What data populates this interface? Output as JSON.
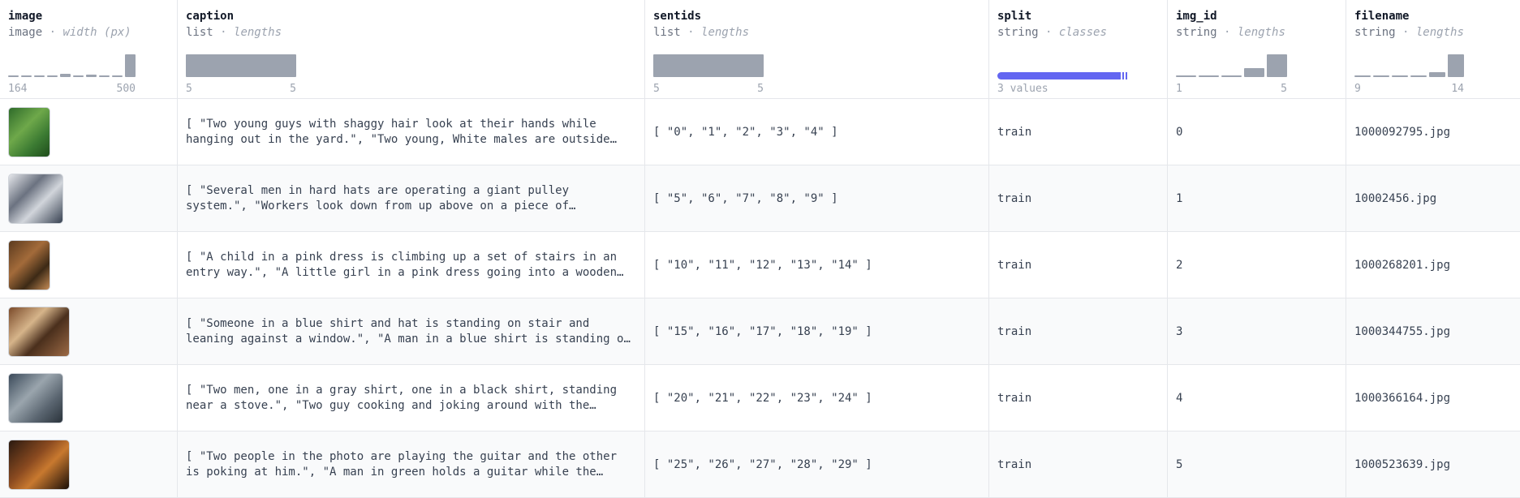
{
  "columns": [
    {
      "name": "image",
      "type": "image",
      "stat": "width (px)",
      "min": "164",
      "max": "500"
    },
    {
      "name": "caption",
      "type": "list",
      "stat": "lengths",
      "min": "5",
      "max": "5"
    },
    {
      "name": "sentids",
      "type": "list",
      "stat": "lengths",
      "min": "5",
      "max": "5"
    },
    {
      "name": "split",
      "type": "string",
      "stat": "classes",
      "summary": "3 values"
    },
    {
      "name": "img_id",
      "type": "string",
      "stat": "lengths",
      "min": "1",
      "max": "5"
    },
    {
      "name": "filename",
      "type": "string",
      "stat": "lengths",
      "min": "9",
      "max": "14"
    }
  ],
  "rows": [
    {
      "caption": "[ \"Two young guys with shaggy hair look at their hands while hanging out in the yard.\", \"Two young, White males are outside near many bushes.\" ]",
      "sentids": "[ \"0\", \"1\", \"2\", \"3\", \"4\" ]",
      "split": "train",
      "img_id": "0",
      "filename": "1000092795.jpg"
    },
    {
      "caption": "[ \"Several men in hard hats are operating a giant pulley system.\", \"Workers look down from up above on a piece of equipment.\" ]",
      "sentids": "[ \"5\", \"6\", \"7\", \"8\", \"9\" ]",
      "split": "train",
      "img_id": "1",
      "filename": "10002456.jpg"
    },
    {
      "caption": "[ \"A child in a pink dress is climbing up a set of stairs in an entry way.\", \"A little girl in a pink dress going into a wooden cabin.\" ]",
      "sentids": "[ \"10\", \"11\", \"12\", \"13\", \"14\" ]",
      "split": "train",
      "img_id": "2",
      "filename": "1000268201.jpg"
    },
    {
      "caption": "[ \"Someone in a blue shirt and hat is standing on stair and leaning against a window.\", \"A man in a blue shirt is standing on a ladder cleaning windows.\" ]",
      "sentids": "[ \"15\", \"16\", \"17\", \"18\", \"19\" ]",
      "split": "train",
      "img_id": "3",
      "filename": "1000344755.jpg"
    },
    {
      "caption": "[ \"Two men, one in a gray shirt, one in a black shirt, standing near a stove.\", \"Two guy cooking and joking around with the camera.\" ]",
      "sentids": "[ \"20\", \"21\", \"22\", \"23\", \"24\" ]",
      "split": "train",
      "img_id": "4",
      "filename": "1000366164.jpg"
    },
    {
      "caption": "[ \"Two people in the photo are playing the guitar and the other is poking at him.\", \"A man in green holds a guitar while the other man observes his shirt.\" ]",
      "sentids": "[ \"25\", \"26\", \"27\", \"28\", \"29\" ]",
      "split": "train",
      "img_id": "5",
      "filename": "1000523639.jpg"
    }
  ],
  "histograms": {
    "image": [
      0.05,
      0.05,
      0.05,
      0.05,
      0.15,
      0.05,
      0.12,
      0.05,
      0.05,
      1.0
    ],
    "caption": [
      1.0
    ],
    "sentids": [
      1.0
    ],
    "img_id": [
      0.05,
      0.05,
      0.05,
      0.4,
      1.0
    ],
    "filename": [
      0.05,
      0.05,
      0.05,
      0.05,
      0.2,
      1.0
    ]
  },
  "colors": {
    "bar": "#9ca3af",
    "accent": "#6366f1",
    "border": "#e5e7eb"
  }
}
